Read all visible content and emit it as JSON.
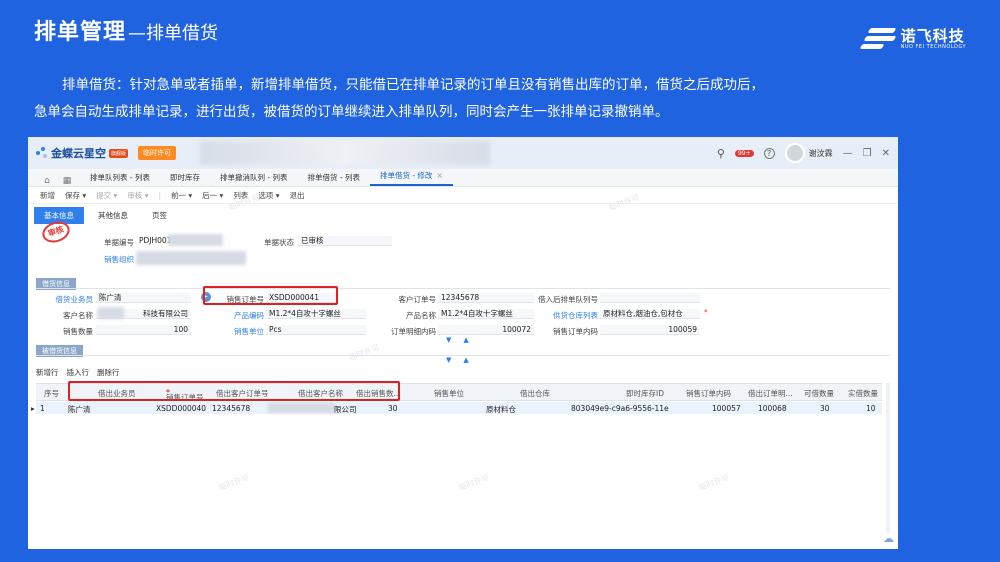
{
  "slide": {
    "title_main": "排单管理",
    "title_sub": "—排单借货",
    "brand_cn": "诺飞科技",
    "brand_en": "NUO FEI TECHNOLOGY",
    "desc_line1": "排单借货：针对急单或者插单，新增排单借货，只能借已在排单记录的订单且没有销售出库的订单，借货之后成功后，",
    "desc_line2": "急单会自动生成排单记录，进行出货，被借货的订单继续进入排单队列，同时会产生一张排单记录撤销单。"
  },
  "app": {
    "logo": "金蝶云星空",
    "logo_tag": "旗舰版",
    "temp_badge": "临时许可",
    "notif_count": "99+",
    "username": "谢汶霖",
    "help_icon": "?"
  },
  "tabs": [
    "排单队列表 - 列表",
    "即时库存",
    "排单撤消队列 - 列表",
    "排单借货 - 列表",
    "排单借货 - 修改"
  ],
  "toolbar": [
    "新增",
    "保存",
    "提交",
    "审核",
    "前一",
    "后一",
    "列表",
    "选项",
    "退出"
  ],
  "subtabs": [
    "基本信息",
    "其他信息",
    "页签"
  ],
  "stamp": "审核",
  "header_form": {
    "bill_no_label": "单据编号",
    "bill_no_value": "PDJH001",
    "bill_status_label": "单据状态",
    "bill_status_value": "已审核",
    "sales_org_label": "销售组织"
  },
  "section_borrow": "借货信息",
  "borrow": {
    "salesman_label": "借货业务员",
    "salesman_value": "陈广清",
    "sales_order_label": "销售订单号",
    "sales_order_value": "XSDD000041",
    "cust_order_label": "客户订单号",
    "cust_order_value": "12345678",
    "queue_label": "借入后排单队列号",
    "customer_label": "客户名称",
    "customer_value": "科技有限公司",
    "product_code_label": "产品编码",
    "product_code_value": "M1.2*4自攻十字螺丝",
    "product_name_label": "产品名称",
    "product_name_value": "M1.2*4自攻十字螺丝",
    "warehouse_label": "供货仓库列表",
    "warehouse_value": "原材料仓,烟油仓,包材仓",
    "qty_label": "销售数量",
    "qty_value": "100",
    "unit_label": "销售单位",
    "unit_value": "Pcs",
    "order_detail_label": "订单明细内码",
    "order_detail_value": "100072",
    "order_inner_label": "销售订单内码",
    "order_inner_value": "100059"
  },
  "section_borrowed": "被借货信息",
  "grid_actions": [
    "新增行",
    "插入行",
    "删除行"
  ],
  "grid": {
    "columns": [
      "序号",
      "借出业务员",
      "销售订单号",
      "借出客户订单号",
      "借出客户名称",
      "借出销售数...",
      "销售单位",
      "借出仓库",
      "即时库存ID",
      "销售订单内码",
      "借出订单明...",
      "可借数量",
      "实借数量"
    ],
    "rows": [
      {
        "seq": "1",
        "salesman": "陈广清",
        "sales_order": "XSDD000040",
        "cust_order": "12345678",
        "customer": "限公司",
        "qty": "30",
        "warehouse": "原材料仓",
        "stock_id": "803049e9-c9a6-9556-11e",
        "order_inner": "100057",
        "detail": "100068",
        "borrowable": "30",
        "actual": "10"
      }
    ]
  },
  "watermark": "临时许可"
}
